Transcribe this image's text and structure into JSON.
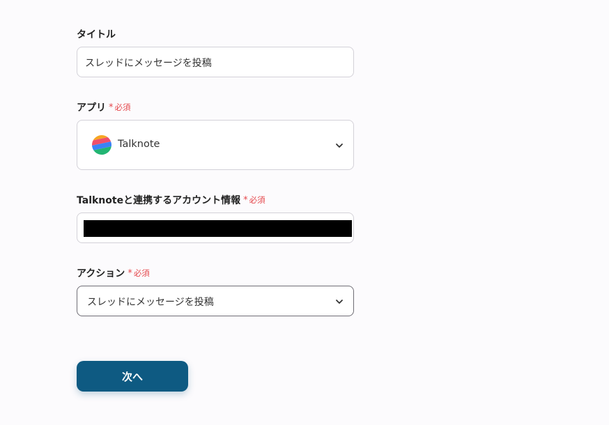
{
  "title_field": {
    "label": "タイトル",
    "value": "スレッドにメッセージを投稿"
  },
  "app_field": {
    "label": "アプリ",
    "required_star": "*",
    "required_text": "必須",
    "selected_app": "Talknote",
    "icon": "talknote-logo"
  },
  "account_field": {
    "label": "Talknoteと連携するアカウント情報",
    "required_star": "*",
    "required_text": "必須",
    "value_redacted": true
  },
  "action_field": {
    "label": "アクション",
    "required_star": "*",
    "required_text": "必須",
    "value": "スレッドにメッセージを投稿"
  },
  "next_button": {
    "label": "次へ"
  },
  "colors": {
    "required": "#e5484d",
    "primary_button": "#0e5a82",
    "redaction": "#000000"
  }
}
